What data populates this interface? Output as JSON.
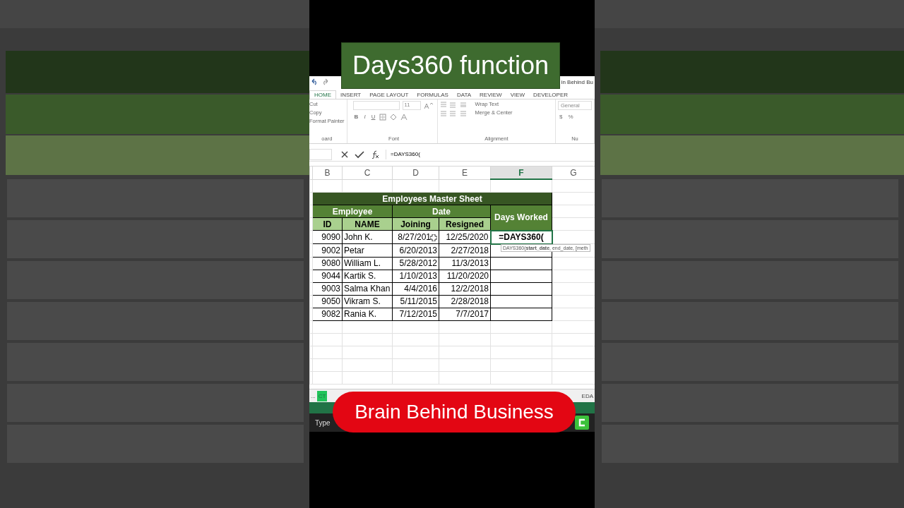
{
  "overlay_title": "Days360 function",
  "overlay_brand": "Brain Behind Business",
  "excel": {
    "title": "in Behind Bu",
    "ribbon_tabs": [
      {
        "label": "HOME",
        "selected": true
      },
      {
        "label": "INSERT",
        "selected": false
      },
      {
        "label": "PAGE LAYOUT",
        "selected": false
      },
      {
        "label": "FORMULAS",
        "selected": false
      },
      {
        "label": "DATA",
        "selected": false
      },
      {
        "label": "REVIEW",
        "selected": false
      },
      {
        "label": "VIEW",
        "selected": false
      },
      {
        "label": "DEVELOPER",
        "selected": false
      }
    ],
    "clipboard": {
      "items": [
        "Cut",
        "Copy",
        "Format Painter"
      ],
      "group": "oard"
    },
    "font": {
      "size": "11",
      "buttons": [
        "B",
        "I",
        "U"
      ],
      "group": "Font"
    },
    "alignment": {
      "wrap": "Wrap Text",
      "merge": "Merge & Center",
      "group": "Alignment"
    },
    "number": {
      "format": "General",
      "symbols": [
        "$",
        "%"
      ],
      "group": "Nu"
    },
    "formula": "=DAYS360(",
    "columns": [
      {
        "label": "B",
        "selected": false
      },
      {
        "label": "C",
        "selected": false
      },
      {
        "label": "D",
        "selected": false
      },
      {
        "label": "E",
        "selected": false
      },
      {
        "label": "F",
        "selected": true
      },
      {
        "label": "G",
        "selected": false
      }
    ],
    "table": {
      "title": "Employees Master Sheet",
      "group_employee": "Employee",
      "group_date": "Date",
      "days_worked": "Days Worked",
      "subheads": [
        "ID",
        "NAME",
        "Joining",
        "Resigned"
      ],
      "rows": [
        {
          "id": "9090",
          "name": "John K.",
          "joining": "8/27/201",
          "resigned": "12/25/2020",
          "days": "=DAYS360("
        },
        {
          "id": "9002",
          "name": "Petar",
          "joining": "6/20/2013",
          "resigned": "2/27/2018"
        },
        {
          "id": "9080",
          "name": "William L.",
          "joining": "5/28/2012",
          "resigned": "11/3/2013"
        },
        {
          "id": "9044",
          "name": "Kartik S.",
          "joining": "1/10/2013",
          "resigned": "11/20/2020"
        },
        {
          "id": "9003",
          "name": "Salma Khan",
          "joining": "4/4/2016",
          "resigned": "12/2/2018"
        },
        {
          "id": "9050",
          "name": "Vikram S.",
          "joining": "5/11/2015",
          "resigned": "2/28/2018"
        },
        {
          "id": "9082",
          "name": "Rania K.",
          "joining": "7/12/2015",
          "resigned": "7/7/2017"
        }
      ]
    },
    "tooltip": "DAYS360(**start_date**, end_date, [meth",
    "sheet_tabs": [
      {
        "label": "...",
        "selected": false
      },
      {
        "label": "CT",
        "selected": true
      },
      {
        "label": "EDA",
        "selected": false
      }
    ],
    "taskbar_search": "Type"
  }
}
